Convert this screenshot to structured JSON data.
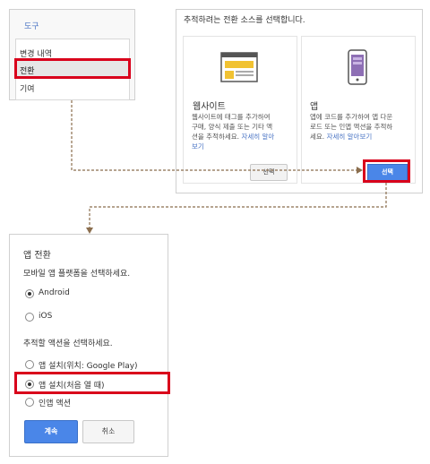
{
  "tools_menu": {
    "title": "도구",
    "items": [
      "변경 내역",
      "전환",
      "기여"
    ]
  },
  "source_panel": {
    "title": "추적하려는 전환 소스를 선택합니다.",
    "website_card": {
      "title": "웹사이트",
      "desc_1": "웹사이트에 태그를 추가하여",
      "desc_2": "구매, 양식 제출 또는 기타 액",
      "desc_3": "션을 추적하세요. ",
      "link_1": "자세히 알아",
      "link_2": "보기",
      "button": "선택"
    },
    "app_card": {
      "title": "앱",
      "desc_1": "앱에 코드를 추가하여 앱 다운",
      "desc_2": "로드 또는 인앱 액션을 추적하",
      "desc_3": "세요. ",
      "link": "자세히 알아보기",
      "button": "선택"
    }
  },
  "app_conversion": {
    "title": "앱 전환",
    "platform_prompt": "모바일 앱 플랫폼을 선택하세요.",
    "platforms": [
      {
        "label": "Android",
        "selected": true
      },
      {
        "label": "iOS",
        "selected": false
      }
    ],
    "action_prompt": "추적할 액션을 선택하세요.",
    "actions": [
      {
        "label": "앱 설치(위치: Google Play)",
        "selected": false
      },
      {
        "label": "앱 설치(처음 열 때)",
        "selected": true
      },
      {
        "label": "인앱 액션",
        "selected": false
      }
    ],
    "continue_button": "계속",
    "cancel_button": "취소"
  },
  "colors": {
    "accent_blue": "#4a86e8",
    "highlight_red": "#d9001b",
    "connector_brown": "#8b6e4e"
  }
}
